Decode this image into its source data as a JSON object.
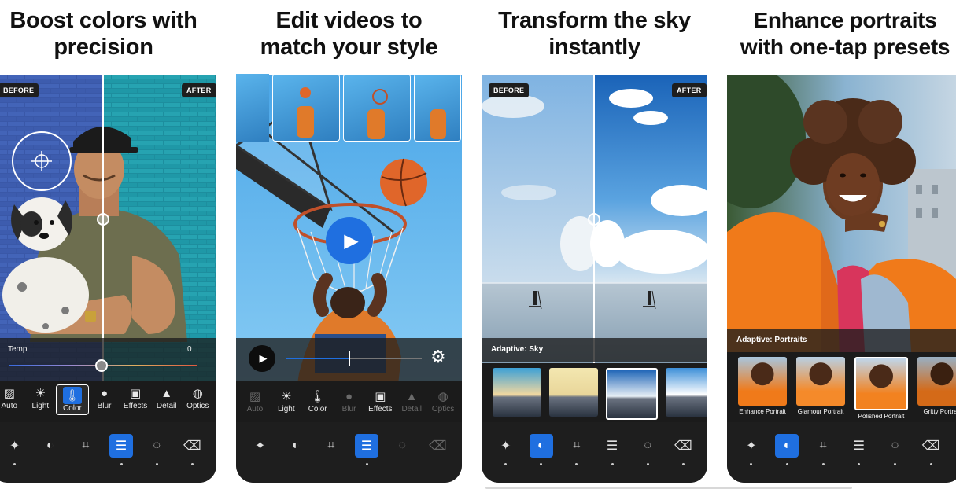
{
  "cards": [
    {
      "caption": [
        "Boost colors with",
        "precision"
      ],
      "before_label": "BEFORE",
      "after_label": "AFTER",
      "slider_label": "Temp",
      "slider_value": "0",
      "tools": [
        {
          "label": "Auto",
          "icon": "auto-icon"
        },
        {
          "label": "Light",
          "icon": "sun-icon"
        },
        {
          "label": "Color",
          "icon": "thermometer-icon"
        },
        {
          "label": "Blur",
          "icon": "drop-icon"
        },
        {
          "label": "Effects",
          "icon": "effects-icon"
        },
        {
          "label": "Detail",
          "icon": "triangle-icon"
        },
        {
          "label": "Optics",
          "icon": "lens-icon"
        }
      ],
      "active_tool": "Color"
    },
    {
      "caption": [
        "Edit videos to",
        "match your style"
      ],
      "tools": [
        {
          "label": "Auto",
          "icon": "auto-icon"
        },
        {
          "label": "Light",
          "icon": "sun-icon"
        },
        {
          "label": "Color",
          "icon": "thermometer-icon"
        },
        {
          "label": "Blur",
          "icon": "drop-icon"
        },
        {
          "label": "Effects",
          "icon": "effects-icon"
        },
        {
          "label": "Detail",
          "icon": "triangle-icon"
        },
        {
          "label": "Optics",
          "icon": "lens-icon"
        }
      ],
      "video_progress": 0.46
    },
    {
      "caption": [
        "Transform the sky",
        "instantly"
      ],
      "before_label": "BEFORE",
      "after_label": "AFTER",
      "adaptive_label": "Adaptive: Sky"
    },
    {
      "caption": [
        "Enhance portraits",
        "with one-tap presets"
      ],
      "adaptive_label": "Adaptive: Portraits",
      "presets": [
        "Enhance Portrait",
        "Glamour Portrait",
        "Polished Portrait",
        "Gritty Portrait"
      ],
      "selected_preset": "Polished Portrait"
    }
  ],
  "bottom_tools": [
    "magic-wand-icon",
    "heal-icon",
    "crop-icon",
    "adjust-icon",
    "vignette-icon",
    "eraser-icon"
  ],
  "icons": {
    "auto": "▨",
    "sun": "☀",
    "thermometer": "🌡",
    "drop": "💧",
    "effects": "▣",
    "triangle": "▲",
    "lens": "◍",
    "play": "▶",
    "gear": "⚙",
    "wand": "✦",
    "heal": "◐",
    "crop": "⌗",
    "adjust": "☰",
    "vignette": "◌",
    "eraser": "⌫"
  },
  "colors": {
    "accent": "#1f6fe0",
    "toolbar": "#1e1e1e"
  }
}
